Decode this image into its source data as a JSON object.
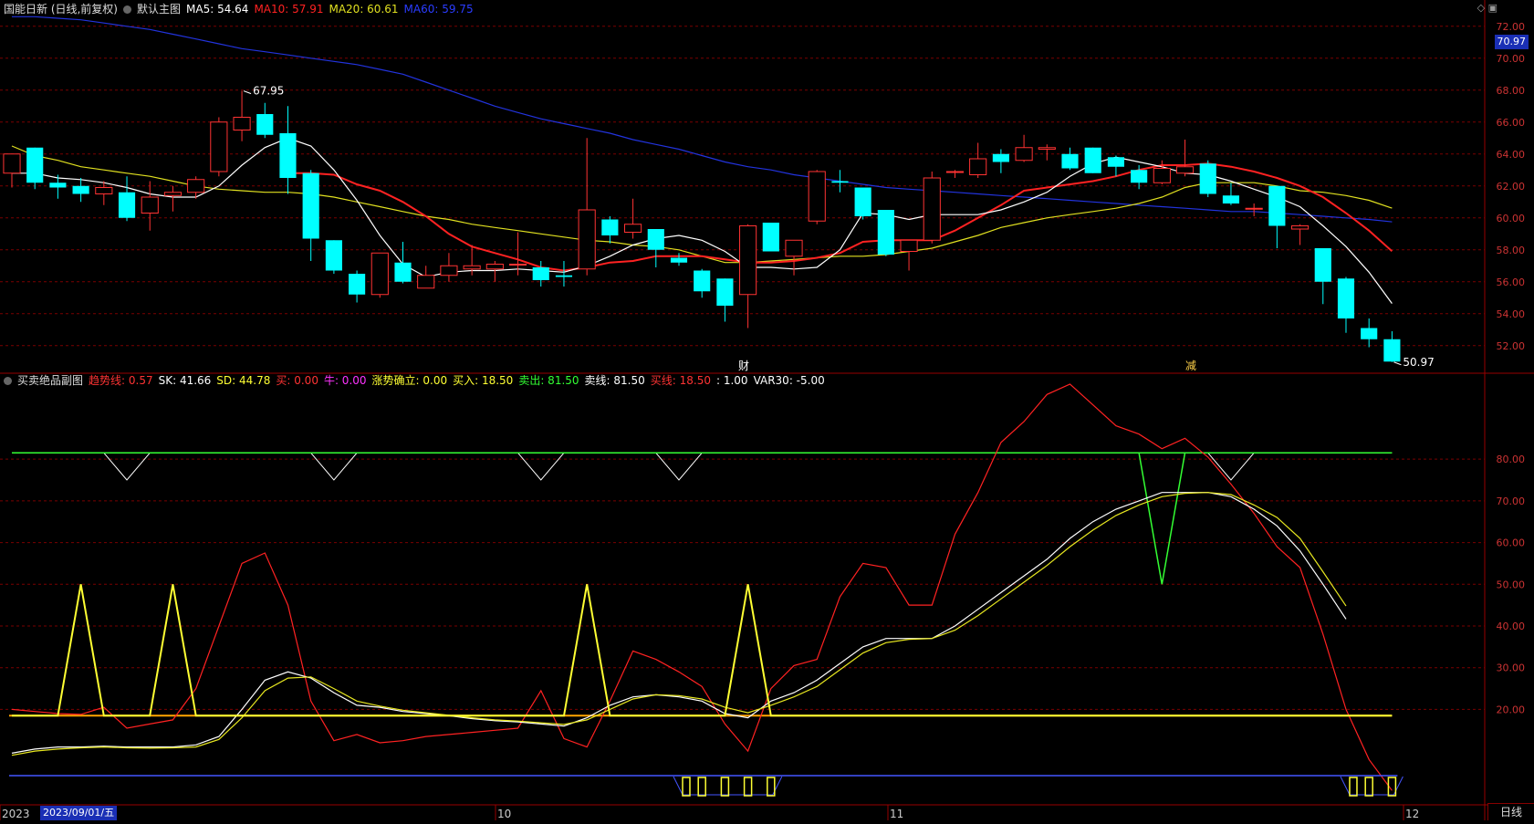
{
  "main_header": {
    "title": "国能日新 (日线,前复权)",
    "indicator_name": "默认主图",
    "ma5": "MA5: 54.64",
    "ma10": "MA10: 57.91",
    "ma20": "MA20: 60.61",
    "ma60": "MA60: 59.75"
  },
  "sub_header": {
    "indicator_name": "买卖绝品副图",
    "items": [
      {
        "text": "趋势线: 0.57",
        "color": "#ff3333"
      },
      {
        "text": "SK: 41.66",
        "color": "#ffffff"
      },
      {
        "text": "SD: 44.78",
        "color": "#ffff33"
      },
      {
        "text": "买: 0.00",
        "color": "#ff3333"
      },
      {
        "text": "牛: 0.00",
        "color": "#ff33ff"
      },
      {
        "text": "涨势确立: 0.00",
        "color": "#ffff33"
      },
      {
        "text": "买入: 18.50",
        "color": "#ffff33"
      },
      {
        "text": "卖出: 81.50",
        "color": "#33ff33"
      },
      {
        "text": "卖线: 81.50",
        "color": "#ffffff"
      },
      {
        "text": "买线: 18.50",
        "color": "#ff3333"
      },
      {
        "text": ": 1.00",
        "color": "#ffffff"
      },
      {
        "text": "VAR30: -5.00",
        "color": "#ffffff"
      }
    ]
  },
  "current_price": "70.97",
  "annotations": {
    "high": "67.95",
    "low": "50.97",
    "mark1": "财",
    "mark2": "减"
  },
  "x_axis": {
    "dates": [
      "2023",
      "2023/09/01/五",
      "10",
      "11",
      "12"
    ]
  },
  "period": "日线",
  "colors": {
    "up": "#ff3333",
    "down": "#00ffff",
    "ma5": "#ffffff",
    "ma10": "#ff2222",
    "ma20": "#e0e020",
    "ma60": "#2233dd",
    "grid": "#7a0000"
  },
  "chart_data": [
    {
      "type": "candlestick",
      "title": "",
      "y_ticks": [
        "72.00",
        "70.00",
        "68.00",
        "66.00",
        "64.00",
        "62.00",
        "60.00",
        "58.00",
        "56.00",
        "54.00",
        "52.00"
      ],
      "ylim": [
        50.5,
        72.5
      ],
      "candles": [
        {
          "o": 62.8,
          "h": 64.0,
          "l": 61.9,
          "c": 64.0
        },
        {
          "o": 64.4,
          "h": 64.4,
          "l": 61.8,
          "c": 62.2
        },
        {
          "o": 62.2,
          "h": 62.7,
          "l": 61.2,
          "c": 61.9
        },
        {
          "o": 62.0,
          "h": 62.5,
          "l": 61.0,
          "c": 61.5
        },
        {
          "o": 61.5,
          "h": 62.3,
          "l": 60.8,
          "c": 61.9
        },
        {
          "o": 61.6,
          "h": 62.6,
          "l": 59.8,
          "c": 60.0
        },
        {
          "o": 60.3,
          "h": 62.3,
          "l": 59.2,
          "c": 61.3
        },
        {
          "o": 61.4,
          "h": 62.0,
          "l": 60.4,
          "c": 61.6
        },
        {
          "o": 61.6,
          "h": 62.6,
          "l": 61.2,
          "c": 62.4
        },
        {
          "o": 62.9,
          "h": 66.3,
          "l": 62.6,
          "c": 66.0
        },
        {
          "o": 65.5,
          "h": 67.95,
          "l": 64.8,
          "c": 66.3
        },
        {
          "o": 66.5,
          "h": 67.2,
          "l": 65.0,
          "c": 65.2
        },
        {
          "o": 65.3,
          "h": 67.0,
          "l": 61.5,
          "c": 62.5
        },
        {
          "o": 62.8,
          "h": 63.0,
          "l": 57.3,
          "c": 58.7
        },
        {
          "o": 58.6,
          "h": 58.6,
          "l": 56.5,
          "c": 56.7
        },
        {
          "o": 56.5,
          "h": 56.7,
          "l": 54.7,
          "c": 55.2
        },
        {
          "o": 55.2,
          "h": 57.8,
          "l": 55.0,
          "c": 57.8
        },
        {
          "o": 57.2,
          "h": 58.5,
          "l": 55.9,
          "c": 56.0
        },
        {
          "o": 55.6,
          "h": 57.0,
          "l": 55.6,
          "c": 56.4
        },
        {
          "o": 56.4,
          "h": 57.8,
          "l": 56.0,
          "c": 57.0
        },
        {
          "o": 56.8,
          "h": 58.3,
          "l": 56.4,
          "c": 57.0
        },
        {
          "o": 56.8,
          "h": 57.3,
          "l": 56.0,
          "c": 57.1
        },
        {
          "o": 57.1,
          "h": 59.1,
          "l": 56.4,
          "c": 57.1
        },
        {
          "o": 56.9,
          "h": 57.3,
          "l": 55.7,
          "c": 56.1
        },
        {
          "o": 56.4,
          "h": 57.3,
          "l": 55.7,
          "c": 56.3
        },
        {
          "o": 56.8,
          "h": 65.0,
          "l": 56.4,
          "c": 60.5
        },
        {
          "o": 59.9,
          "h": 60.1,
          "l": 58.4,
          "c": 58.9
        },
        {
          "o": 59.1,
          "h": 61.2,
          "l": 58.7,
          "c": 59.6
        },
        {
          "o": 59.3,
          "h": 59.3,
          "l": 56.9,
          "c": 58.0
        },
        {
          "o": 57.5,
          "h": 57.8,
          "l": 57.0,
          "c": 57.2
        },
        {
          "o": 56.7,
          "h": 56.8,
          "l": 55.0,
          "c": 55.4
        },
        {
          "o": 56.2,
          "h": 56.2,
          "l": 53.5,
          "c": 54.5
        },
        {
          "o": 55.2,
          "h": 59.6,
          "l": 53.1,
          "c": 59.5
        },
        {
          "o": 59.7,
          "h": 59.7,
          "l": 57.9,
          "c": 57.9
        },
        {
          "o": 57.6,
          "h": 58.6,
          "l": 56.4,
          "c": 58.6
        },
        {
          "o": 59.8,
          "h": 63.0,
          "l": 59.6,
          "c": 62.9
        },
        {
          "o": 62.3,
          "h": 63.0,
          "l": 61.6,
          "c": 62.2
        },
        {
          "o": 61.9,
          "h": 61.9,
          "l": 59.9,
          "c": 60.1
        },
        {
          "o": 60.5,
          "h": 60.5,
          "l": 57.6,
          "c": 57.7
        },
        {
          "o": 57.9,
          "h": 58.6,
          "l": 56.7,
          "c": 58.6
        },
        {
          "o": 58.6,
          "h": 62.9,
          "l": 58.4,
          "c": 62.5
        },
        {
          "o": 62.9,
          "h": 63.0,
          "l": 62.5,
          "c": 62.9
        },
        {
          "o": 62.7,
          "h": 64.7,
          "l": 62.5,
          "c": 63.7
        },
        {
          "o": 64.0,
          "h": 64.3,
          "l": 62.8,
          "c": 63.5
        },
        {
          "o": 63.6,
          "h": 65.2,
          "l": 63.5,
          "c": 64.4
        },
        {
          "o": 64.3,
          "h": 64.6,
          "l": 63.6,
          "c": 64.4
        },
        {
          "o": 64.0,
          "h": 64.4,
          "l": 63.0,
          "c": 63.1
        },
        {
          "o": 64.4,
          "h": 64.4,
          "l": 62.8,
          "c": 62.8
        },
        {
          "o": 63.8,
          "h": 63.9,
          "l": 62.6,
          "c": 63.2
        },
        {
          "o": 63.0,
          "h": 63.3,
          "l": 61.8,
          "c": 62.2
        },
        {
          "o": 62.2,
          "h": 63.6,
          "l": 62.1,
          "c": 63.1
        },
        {
          "o": 62.8,
          "h": 64.9,
          "l": 62.6,
          "c": 63.2
        },
        {
          "o": 63.4,
          "h": 63.6,
          "l": 61.3,
          "c": 61.5
        },
        {
          "o": 61.4,
          "h": 62.2,
          "l": 60.8,
          "c": 60.9
        },
        {
          "o": 60.6,
          "h": 60.9,
          "l": 60.1,
          "c": 60.6
        },
        {
          "o": 62.0,
          "h": 62.0,
          "l": 58.1,
          "c": 59.5
        },
        {
          "o": 59.3,
          "h": 59.6,
          "l": 58.3,
          "c": 59.5
        },
        {
          "o": 58.1,
          "h": 58.1,
          "l": 54.6,
          "c": 56.0
        },
        {
          "o": 56.2,
          "h": 56.3,
          "l": 52.8,
          "c": 53.7
        },
        {
          "o": 53.1,
          "h": 53.7,
          "l": 51.9,
          "c": 52.4
        },
        {
          "o": 52.4,
          "h": 52.9,
          "l": 50.97,
          "c": 51.0
        }
      ],
      "ma5": [
        62.8,
        62.8,
        62.5,
        62.4,
        62.2,
        61.9,
        61.5,
        61.3,
        61.3,
        62.0,
        63.3,
        64.4,
        65.0,
        64.5,
        63.0,
        61.1,
        58.9,
        57.1,
        56.3,
        56.6,
        56.7,
        56.7,
        56.8,
        56.7,
        56.6,
        57.0,
        57.6,
        58.3,
        58.7,
        58.9,
        58.6,
        57.9,
        56.9,
        56.9,
        56.8,
        56.9,
        58.0,
        60.3,
        60.2,
        59.9,
        60.2,
        60.2,
        60.2,
        60.5,
        61.0,
        61.6,
        62.6,
        63.4,
        63.8,
        63.5,
        63.2,
        62.8,
        62.7,
        62.3,
        61.8,
        61.3,
        60.7,
        59.5,
        58.2,
        56.6,
        54.64
      ],
      "ma10": [
        null,
        null,
        null,
        null,
        null,
        null,
        null,
        null,
        null,
        null,
        null,
        null,
        62.8,
        62.8,
        62.7,
        62.1,
        61.7,
        61.0,
        60.1,
        59.0,
        58.2,
        57.8,
        57.4,
        56.9,
        56.7,
        56.9,
        57.2,
        57.3,
        57.6,
        57.6,
        57.6,
        57.4,
        57.2,
        57.2,
        57.3,
        57.5,
        57.8,
        58.5,
        58.6,
        58.6,
        58.6,
        59.2,
        60.0,
        60.8,
        61.7,
        61.9,
        62.1,
        62.3,
        62.6,
        63.0,
        63.3,
        63.3,
        63.4,
        63.2,
        62.9,
        62.5,
        62.0,
        61.3,
        60.3,
        59.2,
        57.91
      ],
      "ma20": [
        64.5,
        63.9,
        63.6,
        63.2,
        63.0,
        62.8,
        62.6,
        62.3,
        62.0,
        61.8,
        61.7,
        61.6,
        61.6,
        61.5,
        61.3,
        61.0,
        60.7,
        60.4,
        60.1,
        59.9,
        59.6,
        59.4,
        59.2,
        59.0,
        58.8,
        58.6,
        58.5,
        58.3,
        58.2,
        58.0,
        57.6,
        57.2,
        57.2,
        57.3,
        57.4,
        57.5,
        57.6,
        57.6,
        57.7,
        57.9,
        58.1,
        58.5,
        58.9,
        59.4,
        59.7,
        60.0,
        60.2,
        60.4,
        60.6,
        60.9,
        61.3,
        61.9,
        62.2,
        62.2,
        62.2,
        62.0,
        61.7,
        61.6,
        61.4,
        61.1,
        60.61
      ],
      "ma60": [
        72.6,
        72.6,
        72.5,
        72.4,
        72.2,
        72.0,
        71.8,
        71.5,
        71.2,
        70.9,
        70.6,
        70.4,
        70.2,
        70.0,
        69.8,
        69.6,
        69.3,
        69.0,
        68.5,
        68.0,
        67.5,
        67.0,
        66.6,
        66.2,
        65.9,
        65.6,
        65.3,
        64.9,
        64.6,
        64.3,
        63.9,
        63.5,
        63.2,
        63.0,
        62.7,
        62.5,
        62.3,
        62.1,
        61.9,
        61.8,
        61.7,
        61.6,
        61.5,
        61.4,
        61.3,
        61.2,
        61.1,
        61.0,
        60.9,
        60.8,
        60.7,
        60.6,
        60.5,
        60.4,
        60.4,
        60.3,
        60.2,
        60.1,
        60.0,
        59.9,
        59.75
      ]
    },
    {
      "type": "line",
      "title": "",
      "y_ticks": [
        "80.00",
        "70.00",
        "60.00",
        "50.00",
        "40.00",
        "30.00",
        "20.00"
      ],
      "ylim": [
        -2,
        96
      ],
      "buy_line": 18.5,
      "sell_line": 81.5,
      "series": [
        {
          "name": "趋势线",
          "values": [
            20,
            19.5,
            19,
            18.8,
            20.5,
            15.5,
            16.5,
            17.5,
            25,
            40,
            55,
            57.5,
            45,
            22,
            12.5,
            14,
            12,
            12.5,
            13.5,
            14,
            14.5,
            15,
            15.5,
            24.5,
            13,
            11,
            22,
            34,
            32,
            29,
            25.5,
            16.5,
            10,
            25,
            30.5,
            32,
            47,
            55,
            54,
            45,
            45,
            62,
            72,
            84,
            89,
            95.5,
            98,
            93,
            88,
            86,
            82.5,
            85,
            80.5,
            74,
            67,
            59,
            54,
            38,
            20,
            8,
            0.57
          ]
        },
        {
          "name": "SK",
          "values": [
            9.5,
            10.5,
            11,
            11,
            11.2,
            11,
            11,
            11,
            11.5,
            13.5,
            20,
            27,
            29,
            27.5,
            24,
            21,
            20.5,
            19.5,
            19,
            18.5,
            17.8,
            17.3,
            17,
            16.5,
            16,
            18,
            21,
            23,
            23.5,
            23,
            22,
            19,
            18,
            22,
            24,
            27,
            31,
            35,
            37,
            37,
            37,
            40,
            44,
            48,
            52,
            56,
            61,
            65,
            68,
            70,
            72,
            72,
            72,
            71,
            68,
            64,
            58,
            50,
            41.66
          ]
        },
        {
          "name": "SD",
          "values": [
            9,
            10,
            10.5,
            10.8,
            11,
            10.8,
            10.7,
            10.8,
            11,
            12.8,
            18,
            24.5,
            27.5,
            27.8,
            25,
            22,
            20.8,
            19.8,
            19.2,
            18.6,
            18,
            17.5,
            17.2,
            16.8,
            16.4,
            17.5,
            20,
            22.5,
            23.5,
            23.3,
            22.5,
            20.5,
            19.2,
            21,
            23,
            25.5,
            29.5,
            33.5,
            36,
            36.8,
            37,
            39,
            42.5,
            46.5,
            50.5,
            54.5,
            59,
            63,
            66.5,
            69,
            71,
            71.8,
            72,
            71.5,
            69,
            66,
            61,
            53,
            44.78
          ]
        },
        {
          "name": "买入",
          "values": [
            18.5,
            18.5,
            18.5,
            50,
            18.5,
            18.5,
            18.5,
            50,
            18.5,
            18.5,
            18.5,
            18.5,
            18.5,
            18.5,
            18.5,
            18.5,
            18.5,
            18.5,
            18.5,
            18.5,
            18.5,
            18.5,
            18.5,
            18.5,
            18.5,
            50,
            18.5,
            18.5,
            18.5,
            18.5,
            18.5,
            18.5,
            50,
            18.5,
            18.5,
            18.5,
            18.5,
            18.5,
            18.5,
            18.5,
            18.5,
            18.5,
            18.5,
            18.5,
            18.5,
            18.5,
            18.5,
            18.5,
            18.5,
            18.5,
            18.5,
            18.5,
            18.5,
            18.5,
            18.5,
            18.5,
            18.5,
            18.5,
            18.5,
            18.5,
            18.5
          ]
        },
        {
          "name": "卖出",
          "values": [
            81.5,
            81.5,
            81.5,
            81.5,
            81.5,
            81.5,
            81.5,
            81.5,
            81.5,
            81.5,
            81.5,
            81.5,
            81.5,
            81.5,
            81.5,
            81.5,
            81.5,
            81.5,
            81.5,
            81.5,
            81.5,
            81.5,
            81.5,
            81.5,
            81.5,
            81.5,
            81.5,
            81.5,
            81.5,
            81.5,
            81.5,
            81.5,
            81.5,
            81.5,
            81.5,
            81.5,
            81.5,
            81.5,
            81.5,
            81.5,
            81.5,
            81.5,
            81.5,
            81.5,
            81.5,
            81.5,
            81.5,
            81.5,
            81.5,
            81.5,
            50,
            81.5,
            81.5,
            81.5,
            81.5,
            81.5,
            81.5,
            81.5,
            81.5,
            81.5,
            81.5
          ]
        }
      ]
    }
  ]
}
